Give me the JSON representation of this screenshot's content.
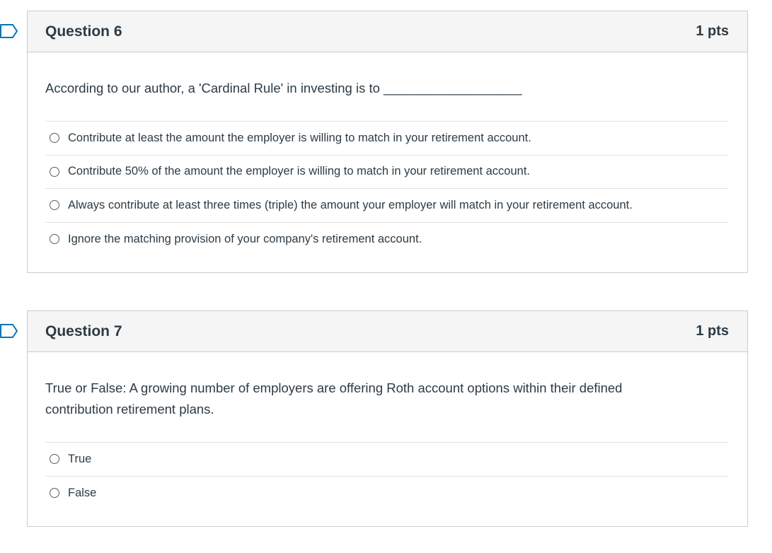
{
  "questions": [
    {
      "title": "Question 6",
      "points": "1 pts",
      "text": "According to our author, a 'Cardinal Rule' in investing is to ___________________",
      "answers": [
        "Contribute at least the amount the employer is willing to match in your retirement account.",
        "Contribute 50% of the amount the employer is willing to match in your retirement account.",
        "Always contribute at least three times (triple) the amount your employer will match in your retirement account.",
        "Ignore the matching provision of your company's retirement account."
      ]
    },
    {
      "title": "Question 7",
      "points": "1 pts",
      "text": "True or False:  A growing number of employers are offering Roth account options within their defined contribution retirement plans.",
      "answers": [
        "True",
        "False"
      ]
    }
  ],
  "colors": {
    "accent": "#0374b5",
    "border": "#c7cdd1",
    "header_bg": "#f5f5f5",
    "text": "#2d3b45"
  },
  "icons": {
    "flag": "flag-bookmark-icon",
    "radio": "radio-unchecked-icon"
  }
}
